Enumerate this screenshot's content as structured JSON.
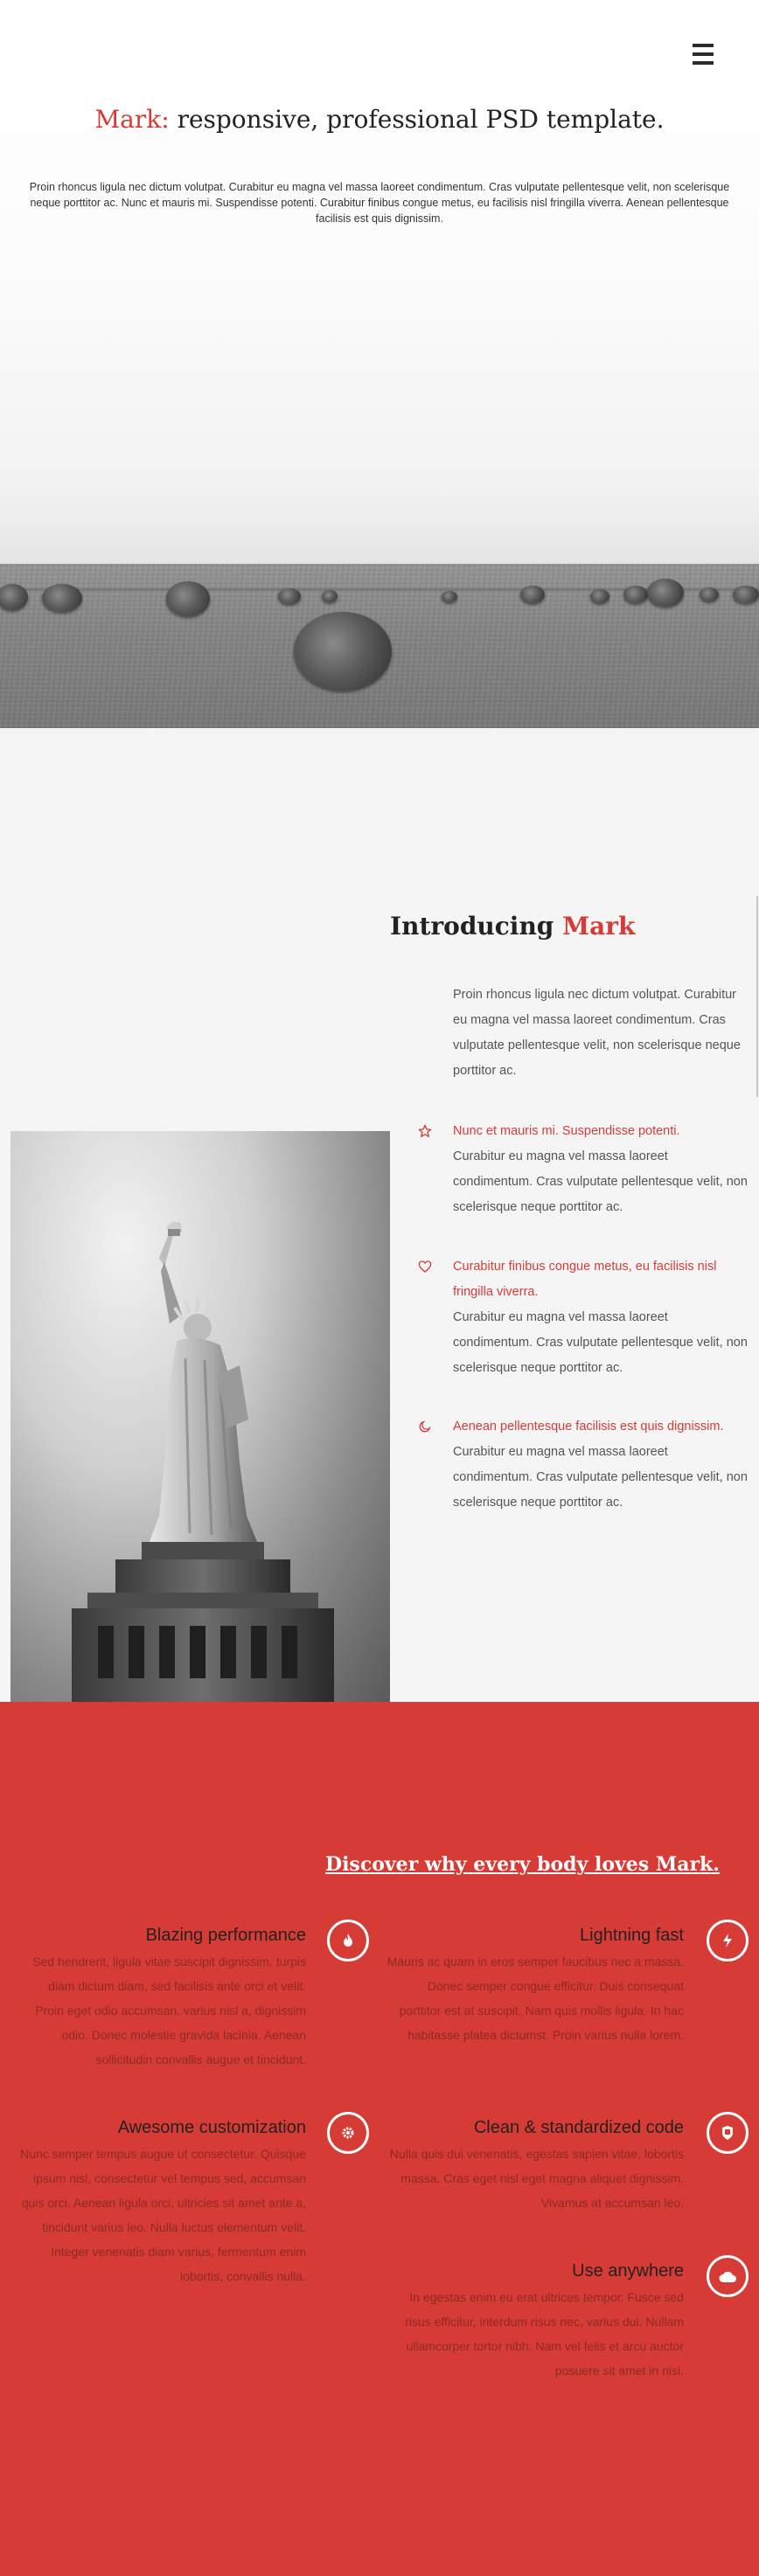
{
  "hero": {
    "title_accent": "Mark:",
    "title_rest": "responsive, professional PSD template.",
    "text": "Proin rhoncus ligula nec dictum volutpat. Curabitur eu magna vel massa laoreet condimentum. Cras vulputate pellentesque velit, non scelerisque neque porttitor ac. Nunc et mauris mi. Suspendisse potenti. Curabitur finibus congue metus, eu facilisis nisl fringilla viverra. Aenean pellentesque facilisis est quis dignissim.",
    "menu_icon": "hamburger-icon"
  },
  "intro": {
    "title_main": "Introducing",
    "title_accent": "Mark",
    "body": "Proin rhoncus ligula nec dictum volutpat. Curabitur eu magna vel massa laoreet condimentum. Cras vulputate pellentesque velit, non scelerisque neque porttitor ac.",
    "features": [
      {
        "icon": "star-icon",
        "heading": "Nunc et mauris mi. Suspendisse potenti.",
        "body": "Curabitur eu magna vel massa laoreet condimentum. Cras vulputate pellentesque velit, non scelerisque neque porttitor ac."
      },
      {
        "icon": "heart-icon",
        "heading": "Curabitur finibus congue metus, eu facilisis nisl fringilla viverra.",
        "body": "Curabitur eu magna vel massa laoreet condimentum. Cras vulputate pellentesque velit, non scelerisque neque porttitor ac."
      },
      {
        "icon": "moon-icon",
        "heading": "Aenean pellentesque facilisis est quis dignissim.",
        "body": "Curabitur eu magna vel massa laoreet condimentum. Cras vulputate pellentesque velit, non scelerisque neque porttitor ac."
      }
    ]
  },
  "features_section": {
    "title": "Discover why every body loves Mark.",
    "items": [
      {
        "title": "Blazing performance",
        "icon": "fire-icon",
        "body": "Sed hendrerit, ligula vitae suscipit dignissim, turpis diam dictum diam, sed facilisis ante orci et velit. Proin eget odio accumsan, varius nisl a, dignissim odio. Donec molestie gravida lacinia. Aenean sollicitudin convallis augue et tincidunt."
      },
      {
        "title": "Lightning fast",
        "icon": "lightning-icon",
        "body": "Mauris ac quam in eros semper faucibus nec a massa. Donec semper congue efficitur. Duis consequat porttitor est at suscipit. Nam quis mollis ligula. In hac habitasse platea dictumst. Proin varius nulla lorem."
      },
      {
        "title": "Awesome customization",
        "icon": "gear-icon",
        "body": "Nunc semper tempus augue ut consectetur. Quisque ipsum nisl, consectetur vel tempus sed, accumsan quis orci. Aenean ligula orci, ultricies sit amet ante a, tincidunt varius leo. Nulla luctus elementum velit. Integer venenatis diam varius, fermentum enim lobortis, convallis nulla."
      },
      {
        "title": "Clean & standardized code",
        "icon": "shield-icon",
        "body": "Nulla quis dui venenatis, egestas sapien vitae, lobortis massa. Cras eget nisl eget magna aliquet dignissim. Vivamus at accumsan leo."
      },
      {
        "title": "Use anywhere",
        "icon": "cloud-icon",
        "body": "In egestas enim eu erat ultrices tempor. Fusce sed risus efficitur, interdum risus nec, varius dui. Nullam ullamcorper tortor nibh. Nam vel felis et arcu auctor posuere sit amet in nisi."
      }
    ]
  },
  "colors": {
    "accent": "#d63b36",
    "intro_bg": "#f5f5f6",
    "dark_text": "#222222"
  }
}
